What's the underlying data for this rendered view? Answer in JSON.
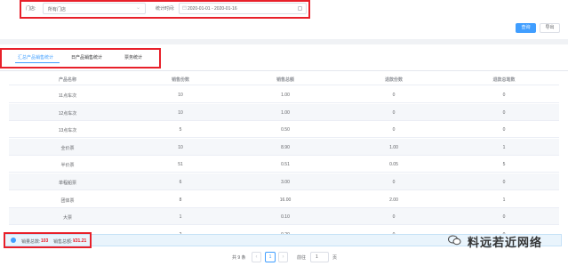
{
  "filters": {
    "store_label": "门店:",
    "store_value": "所有门店",
    "time_label": "统计时间:",
    "time_value": "2020-01-01 - 2020-01-16"
  },
  "actions": {
    "query_label": "查询",
    "export_label": "导出"
  },
  "tabs": [
    {
      "label": "汇总产品销售统计",
      "active": true
    },
    {
      "label": "日产品销售统计",
      "active": false
    },
    {
      "label": "票务统计",
      "active": false
    }
  ],
  "table": {
    "headers": [
      "产品名称",
      "销售份数",
      "销售总额",
      "退款份数",
      "退款总笔数"
    ],
    "rows": [
      [
        "11点车次",
        "10",
        "1.00",
        "0",
        "0"
      ],
      [
        "12点车次",
        "10",
        "1.00",
        "0",
        "0"
      ],
      [
        "13点车次",
        "5",
        "0.50",
        "0",
        "0"
      ],
      [
        "全价票",
        "10",
        "8.90",
        "1.00",
        "1"
      ],
      [
        "半价票",
        "51",
        "0.51",
        "0.05",
        "5"
      ],
      [
        "单程船票",
        "6",
        "3.00",
        "0",
        "0"
      ],
      [
        "团体票",
        "8",
        "16.00",
        "2.00",
        "1"
      ],
      [
        "大票",
        "1",
        "0.10",
        "0",
        "0"
      ],
      [
        "出油票",
        "2",
        "0.20",
        "0",
        "0"
      ]
    ]
  },
  "summary": {
    "count_label": "销量总数:",
    "count_value": "103",
    "amount_label": "销售总额:",
    "amount_value": "¥31.21"
  },
  "pagination": {
    "total": "共 9 条",
    "current_page": "1",
    "goto_label": "前往",
    "goto_value": "1",
    "page_suffix": "页"
  },
  "watermark": {
    "text": "料远若近网络"
  }
}
